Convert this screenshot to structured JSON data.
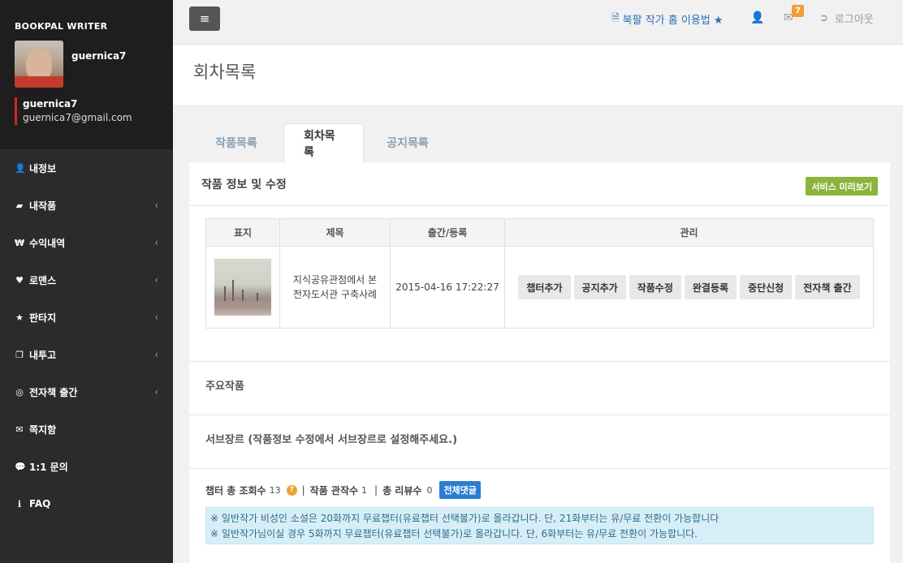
{
  "sidebar": {
    "brand": "BOOKPAL WRITER",
    "avatar_name": "guernica7",
    "user_name": "guernica7",
    "user_email": "guernica7@gmail.com",
    "items": [
      {
        "label": "내정보",
        "icon": "user-icon",
        "glyph": "👤",
        "arrow": ""
      },
      {
        "label": "내작품",
        "icon": "book-icon",
        "glyph": "▰",
        "arrow": "‹"
      },
      {
        "label": "수익내역",
        "icon": "won-icon",
        "glyph": "₩",
        "arrow": "‹"
      },
      {
        "label": "로맨스",
        "icon": "heart-icon",
        "glyph": "♥",
        "arrow": "‹"
      },
      {
        "label": "판타지",
        "icon": "star-icon",
        "glyph": "★",
        "arrow": "‹"
      },
      {
        "label": "내투고",
        "icon": "copy-icon",
        "glyph": "❐",
        "arrow": "‹"
      },
      {
        "label": "전자책 출간",
        "icon": "bullseye-icon",
        "glyph": "◎",
        "arrow": "‹"
      },
      {
        "label": "쪽지함",
        "icon": "envelope-icon",
        "glyph": "✉",
        "arrow": ""
      },
      {
        "label": "1:1 문의",
        "icon": "comments-icon",
        "glyph": "💬",
        "arrow": ""
      },
      {
        "label": "FAQ",
        "icon": "info-icon",
        "glyph": "ℹ",
        "arrow": ""
      }
    ]
  },
  "topbar": {
    "menu_glyph": "≡",
    "guide_label": "북팔 작가 홈 이용법 ★",
    "mail_count": "7",
    "logout_label": "로그아웃"
  },
  "page": {
    "title": "회차목록"
  },
  "tabs": [
    {
      "label": "작품목록",
      "active": false
    },
    {
      "label": "회차목록",
      "active": true
    },
    {
      "label": "공지목록",
      "active": false
    }
  ],
  "panel": {
    "title": "작품 정보 및 수정",
    "preview_label": "서비스 미리보기"
  },
  "table": {
    "headers": [
      "표지",
      "제목",
      "출간/등록",
      "관리"
    ],
    "row": {
      "title_line1": "지식공유관점에서 본",
      "title_line2": "전자도서관 구축사례",
      "date": "2015-04-16 17:22:27",
      "actions": [
        "챕터추가",
        "공지추가",
        "작품수정",
        "완결등록",
        "중단신청",
        "전자책 출간"
      ]
    }
  },
  "sections": {
    "main_works": "주요작품",
    "subgenre": "서브장르 (작품정보 수정에서 서브장르로 설정해주세요.)"
  },
  "stats": {
    "views_label": "챕터 총 조회수",
    "views_value": "13",
    "fans_label": "작품 관작수",
    "fans_value": "1",
    "reviews_label": "총 리뷰수",
    "reviews_value": "0",
    "all_comments_label": "전체댓글"
  },
  "notice": {
    "line1": "※ 일반작가 비성인 소설은 20화까지 무료챕터(유료챕터 선택불가)로 올라갑니다. 단, 21화부터는 유/무료 전환이 가능합니다",
    "line2": "※ 일반작가님이실 경우 5화까지 무료챕터(유료챕터 선택불가)로 올라갑니다. 단, 6화부터는 유/무료 전환이 가능합니다."
  }
}
